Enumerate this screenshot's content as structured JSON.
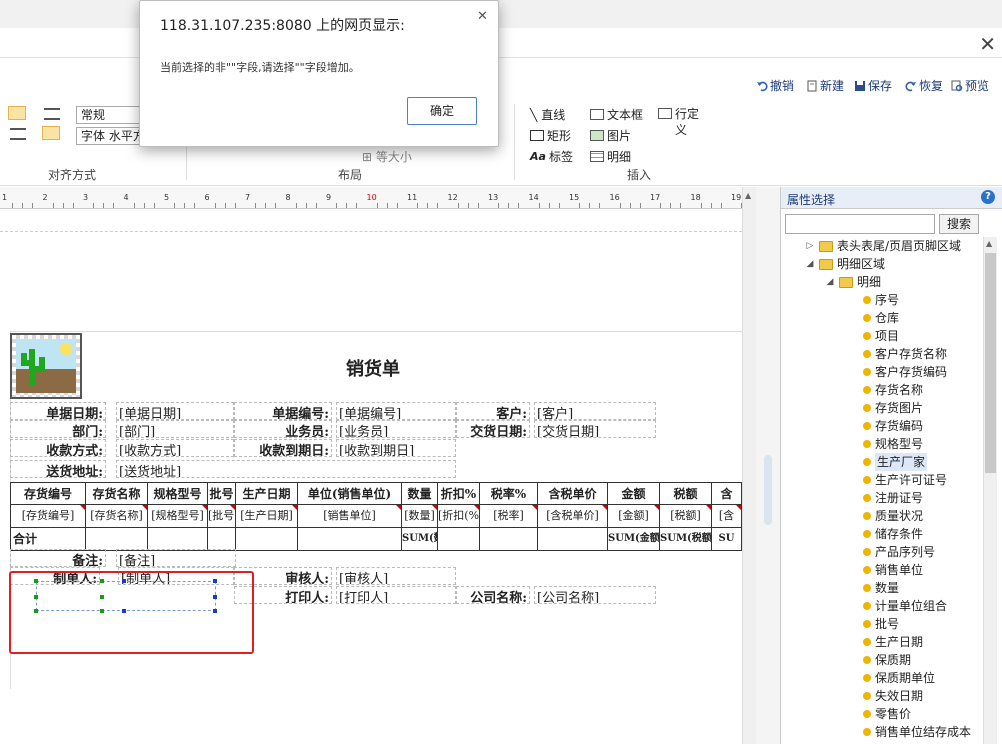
{
  "toolbar": {
    "undo": "撤销",
    "new": "新建",
    "save": "保存",
    "redo": "恢复",
    "preview": "预览"
  },
  "ribbon": {
    "font_style_value": "常规",
    "font_align_value": "字体 水平方",
    "group_align": "对齐方式",
    "group_layout": "布局",
    "group_insert": "插入",
    "same_size": "等大小",
    "insert_line": "直线",
    "insert_textbox": "文本框",
    "insert_row": "行定义",
    "insert_rect": "矩形",
    "insert_image": "图片",
    "insert_label": "标签",
    "insert_detail": "明细"
  },
  "ruler": [
    "1",
    "2",
    "3",
    "4",
    "5",
    "6",
    "7",
    "8",
    "9",
    "10",
    "11",
    "12",
    "13",
    "14",
    "15",
    "16",
    "17",
    "18",
    "19",
    "20"
  ],
  "form": {
    "title": "销货单",
    "header": [
      {
        "label": "单据日期:",
        "value": "[单据日期]"
      },
      {
        "label": "单据编号:",
        "value": "[单据编号]"
      },
      {
        "label": "客户:",
        "value": "[客户]"
      },
      {
        "label": "部门:",
        "value": "[部门]"
      },
      {
        "label": "业务员:",
        "value": "[业务员]"
      },
      {
        "label": "交货日期:",
        "value": "[交货日期]"
      },
      {
        "label": "收款方式:",
        "value": "[收款方式]"
      },
      {
        "label": "收款到期日:",
        "value": "[收款到期日]"
      },
      {
        "label": "送货地址:",
        "value": "[送货地址]"
      }
    ],
    "columns": [
      "存货编号",
      "存货名称",
      "规格型号",
      "批号",
      "生产日期",
      "单位(销售单位)",
      "数量",
      "折扣%",
      "税率%",
      "含税单价",
      "金额",
      "税额",
      "含"
    ],
    "row_values": [
      "[存货编号]",
      "[存货名称]",
      "[规格型号]",
      "[批号]",
      "[生产日期]",
      "[销售单位]",
      "[数量]",
      "[折扣(%)]",
      "[税率]",
      "[含税单价]",
      "[金额]",
      "[税额]",
      "[含"
    ],
    "total_label": "合计",
    "sum_qty": "SUM(数量)",
    "sum_amount": "SUM(金额)",
    "sum_tax": "SUM(税额)",
    "sum_more": "SU",
    "footer": [
      {
        "label": "备注:",
        "value": "[备注]"
      },
      {
        "label": "制单人:",
        "value": "[制单人]"
      },
      {
        "label": "审核人:",
        "value": "[审核人]"
      },
      {
        "label": "打印人:",
        "value": "[打印人]"
      },
      {
        "label": "公司名称:",
        "value": "[公司名称]"
      }
    ]
  },
  "panel": {
    "title": "属性选择",
    "search_button": "搜索",
    "search_placeholder": "",
    "tree": [
      {
        "label": "表头表尾/页眉页脚区域",
        "type": "folder",
        "level": 0,
        "twisty": "▷"
      },
      {
        "label": "明细区域",
        "type": "folder",
        "level": 0,
        "twisty": "◢"
      },
      {
        "label": "明细",
        "type": "folder",
        "level": 1,
        "twisty": "◢"
      },
      {
        "label": "序号",
        "type": "leaf"
      },
      {
        "label": "仓库",
        "type": "leaf"
      },
      {
        "label": "项目",
        "type": "leaf"
      },
      {
        "label": "客户存货名称",
        "type": "leaf"
      },
      {
        "label": "客户存货编码",
        "type": "leaf"
      },
      {
        "label": "存货名称",
        "type": "leaf"
      },
      {
        "label": "存货图片",
        "type": "leaf"
      },
      {
        "label": "存货编码",
        "type": "leaf"
      },
      {
        "label": "规格型号",
        "type": "leaf"
      },
      {
        "label": "生产厂家",
        "type": "leaf",
        "selected": true
      },
      {
        "label": "生产许可证号",
        "type": "leaf"
      },
      {
        "label": "注册证号",
        "type": "leaf"
      },
      {
        "label": "质量状况",
        "type": "leaf"
      },
      {
        "label": "储存条件",
        "type": "leaf"
      },
      {
        "label": "产品序列号",
        "type": "leaf"
      },
      {
        "label": "销售单位",
        "type": "leaf"
      },
      {
        "label": "数量",
        "type": "leaf"
      },
      {
        "label": "计量单位组合",
        "type": "leaf"
      },
      {
        "label": "批号",
        "type": "leaf"
      },
      {
        "label": "生产日期",
        "type": "leaf"
      },
      {
        "label": "保质期",
        "type": "leaf"
      },
      {
        "label": "保质期单位",
        "type": "leaf"
      },
      {
        "label": "失效日期",
        "type": "leaf"
      },
      {
        "label": "零售价",
        "type": "leaf"
      },
      {
        "label": "销售单位结存成本",
        "type": "leaf"
      }
    ]
  },
  "dialog": {
    "title": "118.31.107.235:8080 上的网页显示:",
    "message": "当前选择的非\"\"字段,请选择\"\"字段增加。",
    "ok": "确定"
  },
  "colors": {
    "selection_box": "#e02020",
    "accent": "#1d3b7a",
    "leaf_dot": "#f0b400"
  }
}
